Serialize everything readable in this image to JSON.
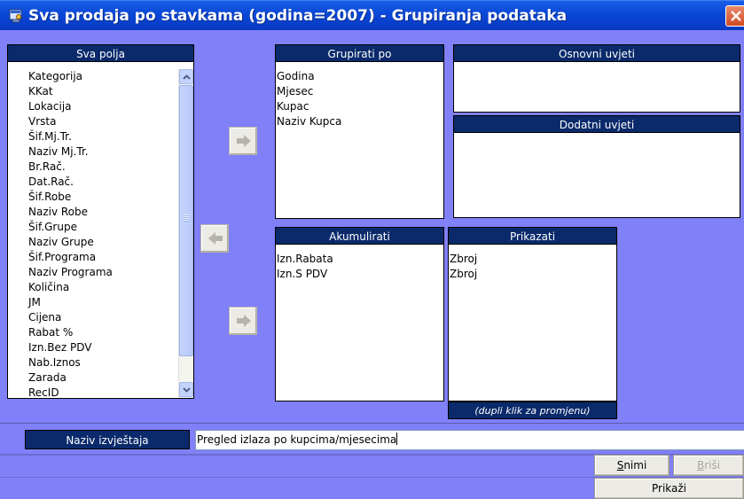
{
  "window": {
    "title": "Sva prodaja po stavkama (godina=2007) - Grupiranja podataka"
  },
  "sva_polja": {
    "header": "Sva polja",
    "items": [
      "Kategorija",
      "KKat",
      "Lokacija",
      "Vrsta",
      "Šif.Mj.Tr.",
      "Naziv Mj.Tr.",
      "Br.Rač.",
      "Dat.Rač.",
      "Šif.Robe",
      "Naziv Robe",
      "Šif.Grupe",
      "Naziv Grupe",
      "Šif.Programa",
      "Naziv Programa",
      "Količina",
      "JM",
      "Cijena",
      "Rabat %",
      "Izn.Bez PDV",
      "Nab.Iznos",
      "Zarada",
      "RecID"
    ]
  },
  "grupirati_po": {
    "header": "Grupirati po",
    "items": [
      "Godina",
      "Mjesec",
      "Kupac",
      "Naziv Kupca"
    ]
  },
  "osnovni_uvjeti": {
    "header": "Osnovni uvjeti"
  },
  "dodatni_uvjeti": {
    "header": "Dodatni uvjeti"
  },
  "akumulirati": {
    "header": "Akumulirati",
    "items": [
      "Izn.Rabata",
      "Izn.S PDV"
    ]
  },
  "prikazati": {
    "header": "Prikazati",
    "items": [
      "Zbroj",
      "Zbroj"
    ],
    "footer": "(dupli klik za promjenu)"
  },
  "report": {
    "label": "Naziv izvještaja",
    "value": "Pregled izlaza po kupcima/mjesecima"
  },
  "buttons": {
    "save_prefix": "S",
    "save_rest": "nimi",
    "delete_prefix": "B",
    "delete_rest": "riši",
    "show": "Prikaži"
  },
  "colors": {
    "background": "#8080f8",
    "header": "#0a2a6b",
    "titlebar": "#0a47d6"
  }
}
